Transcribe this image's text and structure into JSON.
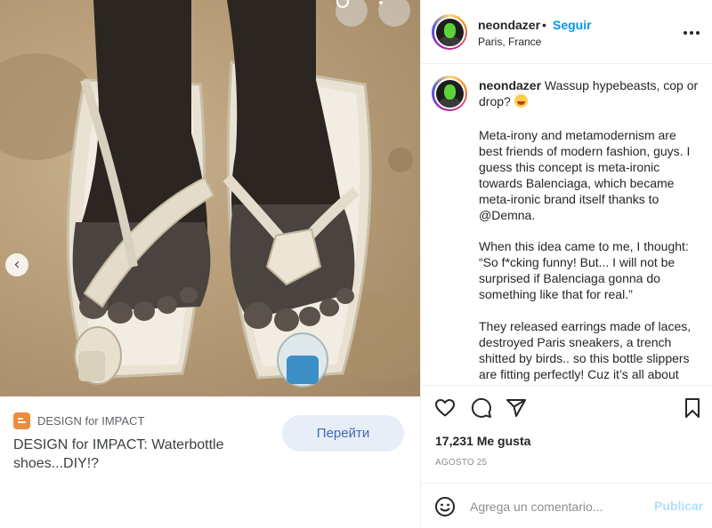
{
  "post": {
    "username": "neondazer",
    "follow_dot": "•",
    "follow_label": "Seguir",
    "location": "Paris, France"
  },
  "caption": {
    "username": "neondazer",
    "intro": "Wassup hypebeasts, cop or drop?",
    "paragraphs": [
      "Meta-irony and metamodernism are best friends of modern fashion, guys. I guess this concept is meta-ironic towards Balenciaga, which became meta-ironic brand itself thanks to @Demna.",
      "When this idea came to me, I thought: “So f*cking funny! But... I will not be surprised if Balenciaga gonna do something like that for real.”",
      "They released earrings made of laces, destroyed Paris sneakers, a trench shitted by birds.. so this bottle slippers are fitting perfectly! Cuz it’s all about"
    ]
  },
  "stats": {
    "likes": "17,231 Me gusta",
    "date": "AGOSTO 25"
  },
  "comment_box": {
    "placeholder": "Agrega un comentario...",
    "post_label": "Publicar"
  },
  "ad": {
    "source": "DESIGN for IMPACT",
    "title": "DESIGN for IMPACT: Waterbottle shoes...DIY!?",
    "button_label": "Перейти"
  },
  "icons": {
    "prev": "chevron-left-icon",
    "more": "more-horizontal-icon",
    "like": "heart-icon",
    "comment": "comment-icon",
    "share": "send-icon",
    "save": "bookmark-icon",
    "emoji": "smiley-icon",
    "ad_source": "blogger-icon"
  },
  "colors": {
    "link_blue": "#0095f6",
    "post_disabled": "#b2dffc",
    "ad_button_bg": "#e8eef8",
    "ad_button_text": "#3f6bb3",
    "blogger_orange": "#f08a3e"
  }
}
